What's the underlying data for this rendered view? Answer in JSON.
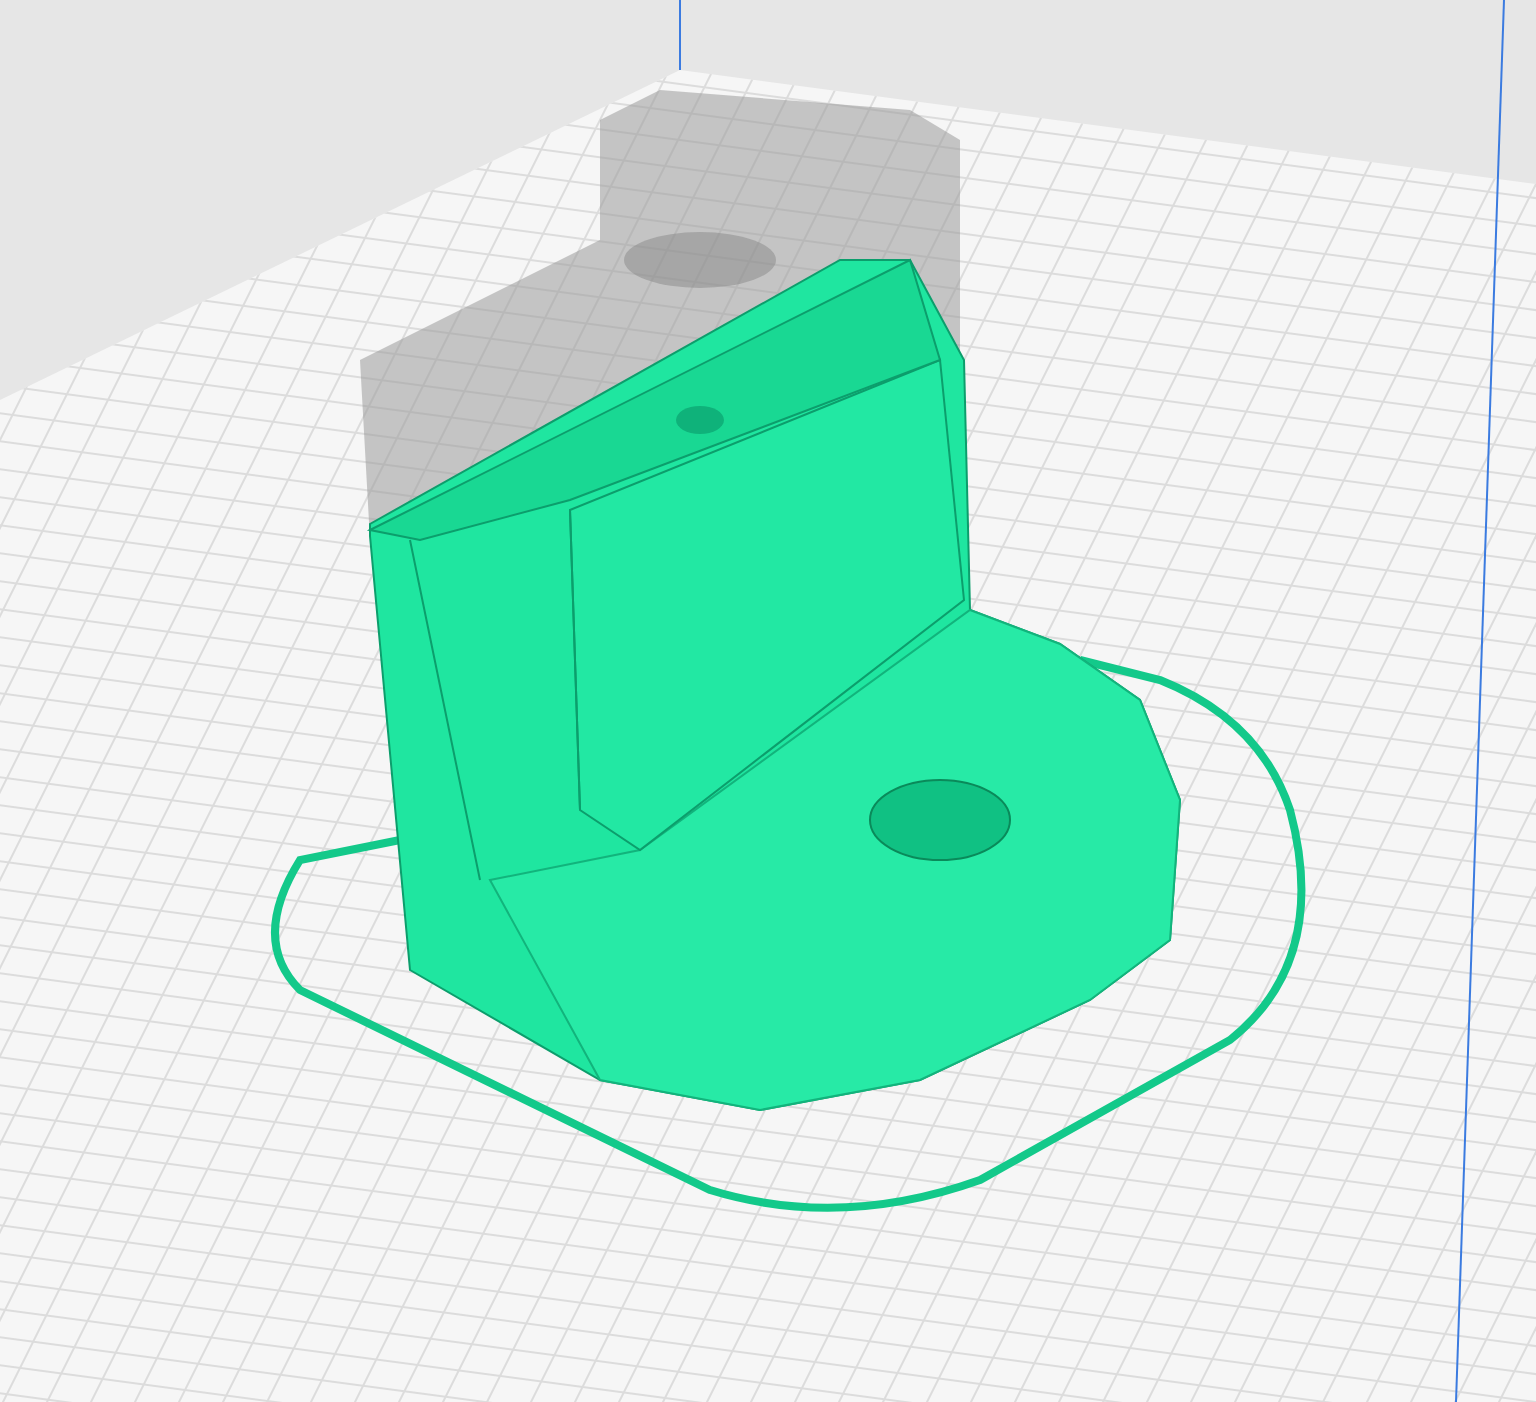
{
  "viewport": {
    "model": {
      "kind": "sliced",
      "ghost": true
    },
    "skirt": {
      "shown": true
    }
  }
}
